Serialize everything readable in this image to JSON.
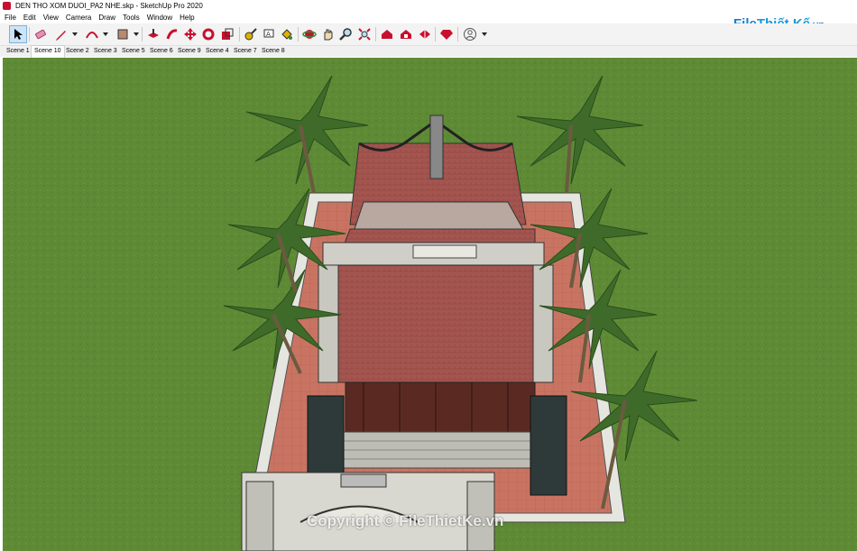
{
  "window": {
    "title": "DEN THO XOM DUOI_PA2 NHE.skp - SketchUp Pro 2020"
  },
  "menu": [
    "File",
    "Edit",
    "View",
    "Camera",
    "Draw",
    "Tools",
    "Window",
    "Help"
  ],
  "toolbar": {
    "tools": [
      "select-icon",
      "eraser-icon",
      "pencil-icon",
      "arc-icon",
      "rectangle-icon",
      "push-pull-icon",
      "follow-me-icon",
      "move-icon",
      "rotate-icon",
      "scale-icon",
      "tape-measure-icon",
      "text-icon",
      "paint-bucket-icon",
      "orbit-icon",
      "pan-icon",
      "zoom-icon",
      "zoom-extents-icon",
      "warehouse-icon",
      "extension-warehouse-icon",
      "layout-icon",
      "ruby-icon",
      "account-icon"
    ]
  },
  "scenes": [
    "Scene 1",
    "Scene 10",
    "Scene 2",
    "Scene 3",
    "Scene 5",
    "Scene 6",
    "Scene 9",
    "Scene 4",
    "Scene 7",
    "Scene 8"
  ],
  "active_scene": "Scene 10",
  "logo": {
    "part1": "File",
    "part2": "Thiết Kế",
    "part3": ".vn"
  },
  "watermark": "Copyright © FileThietKe.vn",
  "colors": {
    "grass": "#5e8a35",
    "roof": "#a4554f",
    "floor": "#c97462",
    "wall": "#e6e6e0",
    "accent": "#1a7fc4"
  }
}
